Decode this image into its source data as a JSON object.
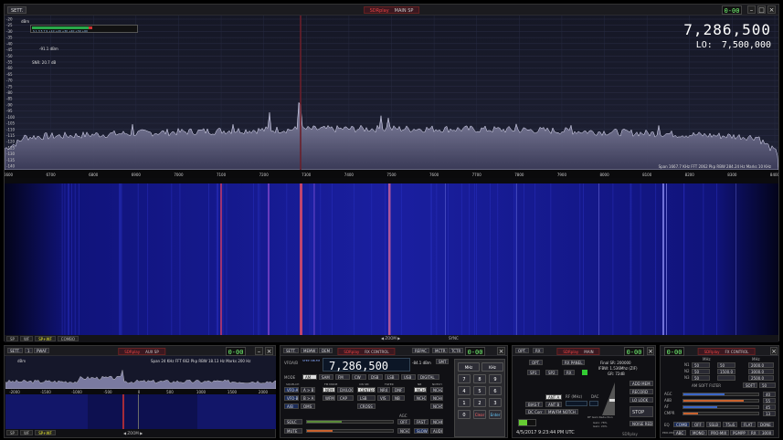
{
  "main": {
    "setup_label": "SETT.",
    "title_brand": "SDRplay",
    "title_name": "MAIN SP",
    "indicator": "0-00",
    "frequency": "7,286,500",
    "lo_label": "LO:",
    "lo_value": "7,500,000",
    "dbm_label": "dBm",
    "smeter_scale": "S  1  3  5  7  9  +10 +20 +30 +40 +50 +60",
    "level_readout": "-91.1 dBm",
    "snr_readout": "SNR: 20.7 dB",
    "y_labels": [
      "-20",
      "-25",
      "-30",
      "-35",
      "-40",
      "-45",
      "-50",
      "-55",
      "-60",
      "-65",
      "-70",
      "-75",
      "-80",
      "-85",
      "-90",
      "-95",
      "-100",
      "-105",
      "-110",
      "-115",
      "-120",
      "-125",
      "-130",
      "-135",
      "-140"
    ],
    "x_labels": [
      "6600",
      "6700",
      "6800",
      "6900",
      "7000",
      "7100",
      "7200",
      "7300",
      "7400",
      "7500",
      "7600",
      "7700",
      "7800",
      "7900",
      "8000",
      "8100",
      "8200",
      "8300",
      "8400"
    ],
    "span_info": "Span 1667.7 KHz  FFT 2062 Pkp  RBW 284.24 Hz  Marks 10 KHz",
    "side_buttons_top": [
      "SP",
      "WF",
      "SP+WF",
      "COMBO"
    ],
    "side_buttons_bottom": [
      "SP",
      "WF",
      "SP+WF",
      "COMBO"
    ],
    "zoom_label": "ZOOM",
    "sync_label": "SYNC"
  },
  "aux": {
    "setup_label": "SETT.",
    "num": "1",
    "pwaf": "PWAF",
    "title_brand": "SDRplay",
    "title_name": "AUX SP",
    "indicator": "0-00",
    "dbm_label": "dBm",
    "info": "Span 24 KHz  FFT 662 Pkp  RBW 18.13 Hz  Marks 200 Hz",
    "x_labels": [
      "-2000",
      "-1500",
      "-1000",
      "-500",
      "0",
      "500",
      "1000",
      "1500",
      "2000"
    ],
    "buttons": [
      "SP",
      "WF",
      "SP+WF"
    ],
    "zoom_label": "ZOOM"
  },
  "rx": {
    "tabs": [
      "SETT.",
      "MEMW",
      "DEM"
    ],
    "title_brand": "SDRplay",
    "title_name": "RX CONTROL",
    "right_tabs": [
      "REPAC",
      "MCTR",
      "TCTR"
    ],
    "indicator": "0-00",
    "vfo_label": "VFOA/B",
    "vfo_sub": "STEP:\nNB-FM",
    "frequency": "7,286,500",
    "level": "-84.1 dBm",
    "smt_label": "SMT",
    "mode_label": "MODE",
    "modes": [
      "AM",
      "SAM",
      "FM",
      "CW",
      "DSB",
      "LSB",
      "USB",
      "DIGITAL"
    ],
    "row_labels": [
      "SQUELCH",
      "FM MODE",
      "CW SM",
      "FILTER",
      "NB",
      "NOTCH"
    ],
    "row2": [
      "VFO-A",
      "A > B",
      "NFM",
      "DX/LOC",
      "CENTER",
      "NR4",
      "DNF",
      "NCH1",
      "NCH2"
    ],
    "row3": [
      "VFO-B",
      "B > A",
      "WFM",
      "CAP",
      "LSB",
      "VIS",
      "NB",
      "NCH3",
      "NCH4"
    ],
    "row4": [
      "A/B",
      "QMS",
      "CROSS",
      "NCH5"
    ],
    "squelch_label": "SQLC",
    "mute_label": "MUTE",
    "agc": [
      "AGC",
      "OFF",
      "FAST",
      "NCH6",
      "NCH7",
      "SLOW",
      "AUDIO"
    ],
    "keypad": [
      "7",
      "8",
      "9",
      "4",
      "5",
      "6",
      "1",
      "2",
      "3",
      "0",
      "Clear",
      "Enter"
    ],
    "keypad_top": [
      "MHz",
      "KHz"
    ]
  },
  "main_panel": {
    "tabs": [
      "OPT.",
      "RX"
    ],
    "title_brand": "SDRplay",
    "title_name": "MAIN",
    "indicator": "0-00",
    "buttons_top": [
      "OPT.",
      "RX PANEL"
    ],
    "buttons_row2": [
      "SP1",
      "SP2",
      "RX"
    ],
    "final_sr": "Final SR: 200000",
    "ifbw": "IFBW: 1.536Mhz (ZIF)",
    "gr": "GR: 72dB",
    "buttons_mid": [
      "ANT A",
      "ANT B",
      "BIAS-T"
    ],
    "rf_label": "RF (MHz)",
    "dac_label": "DAC",
    "right_buttons": [
      "ADD MEM",
      "RECORD",
      "LO LOCK",
      "STOP",
      "NOISE RED"
    ],
    "rf_gain": "RF Gain Reduction",
    "gain_l": "Gain: 76%",
    "gain_r": "Gain: 24%",
    "dcc": "DC Corr",
    "notch": "MW/FM NOTCH",
    "date": "4/5/2017 9:23:44 PM UTC",
    "logo": "SDRplay"
  },
  "fx": {
    "indicator": "0-00",
    "title_brand": "SDRplay",
    "title_name": "FX CONTROL",
    "col_headers": [
      "MHz",
      "MHz"
    ],
    "rows": [
      {
        "lab": "N1",
        "a": "50",
        "b": "50",
        "c": "2000.0"
      },
      {
        "lab": "N2",
        "a": "50",
        "b": "1500.0",
        "c": "3000.0"
      },
      {
        "lab": "N3",
        "a": "50",
        "b": "",
        "c": "2500.0"
      }
    ],
    "am_label": "AM SOFT FILTER",
    "soft_buttons": [
      "SOFT",
      "50"
    ],
    "bars": [
      {
        "label": "AGC",
        "val": "40",
        "frac": 0.55,
        "color": "#3a66c8"
      },
      {
        "label": "A8B",
        "val": "55",
        "frac": 0.8,
        "color": "#c9622e"
      },
      {
        "label": "AF",
        "val": "45",
        "frac": 0.45,
        "color": "#3a66c8"
      },
      {
        "label": "CMPR",
        "val": "13",
        "frac": 0.2,
        "color": "#c9622e"
      }
    ],
    "row_a": [
      "EQ",
      "COMB",
      "OFF",
      "SSLB",
      "75uS",
      "FLAT",
      "DONE"
    ],
    "row_b": [
      "ABC",
      "MONO",
      "PRO-MIX",
      "PGMPP",
      "RX",
      "3000"
    ],
    "pro_label": "PRO-MIX"
  }
}
